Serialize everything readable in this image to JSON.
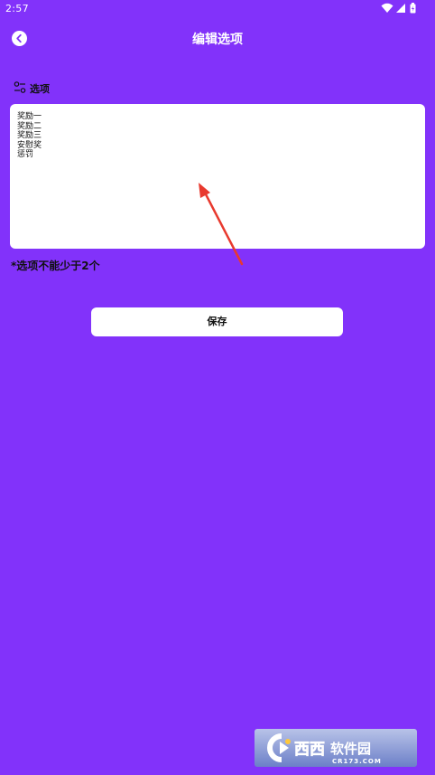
{
  "status_bar": {
    "time": "2:57",
    "icons": [
      "wifi-icon",
      "signal-icon",
      "battery-icon"
    ]
  },
  "app_bar": {
    "back_icon": "back-arrow-icon",
    "title": "编辑选项"
  },
  "options_section": {
    "icon": "settings-sliders-icon",
    "label": "选项",
    "textarea_value": "奖励一\n奖励二\n奖励三\n安慰奖\n惩罚",
    "hint": "*选项不能少于2个"
  },
  "actions": {
    "save_label": "保存"
  },
  "watermark": {
    "text": "西西软件园",
    "domain": "CR173.COM"
  },
  "colors": {
    "background": "#8232fa",
    "surface": "#ffffff",
    "text": "#111111",
    "annotation_arrow": "#e8392e"
  }
}
